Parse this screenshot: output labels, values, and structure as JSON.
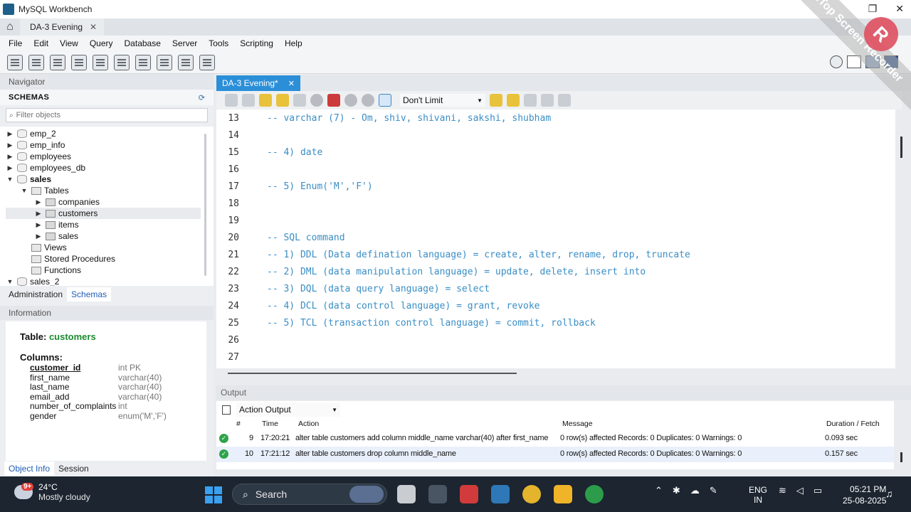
{
  "window": {
    "title": "MySQL Workbench",
    "controls": [
      "❐",
      "✕"
    ]
  },
  "connection_tab": {
    "label": "DA-3 Evening",
    "close": "✕"
  },
  "menu": [
    "File",
    "Edit",
    "View",
    "Query",
    "Database",
    "Server",
    "Tools",
    "Scripting",
    "Help"
  ],
  "navigator": {
    "title": "Navigator",
    "schemas_title": "SCHEMAS",
    "filter_placeholder": "Filter objects",
    "tree": [
      {
        "label": "emp_2",
        "kind": "schema",
        "arrow": "▶"
      },
      {
        "label": "emp_info",
        "kind": "schema",
        "arrow": "▶"
      },
      {
        "label": "employees",
        "kind": "schema",
        "arrow": "▶"
      },
      {
        "label": "employees_db",
        "kind": "schema",
        "arrow": "▶"
      },
      {
        "label": "sales",
        "kind": "schema",
        "arrow": "▼"
      },
      {
        "label": "Tables",
        "kind": "folder",
        "arrow": "▼"
      },
      {
        "label": "companies",
        "kind": "table",
        "arrow": "▶"
      },
      {
        "label": "customers",
        "kind": "table",
        "arrow": "▶"
      },
      {
        "label": "items",
        "kind": "table",
        "arrow": "▶"
      },
      {
        "label": "sales",
        "kind": "table",
        "arrow": "▶"
      },
      {
        "label": "Views",
        "kind": "folder",
        "arrow": ""
      },
      {
        "label": "Stored Procedures",
        "kind": "folder",
        "arrow": ""
      },
      {
        "label": "Functions",
        "kind": "folder",
        "arrow": ""
      },
      {
        "label": "sales_2",
        "kind": "schema",
        "arrow": "▼"
      }
    ],
    "tabs": [
      "Administration",
      "Schemas"
    ]
  },
  "information": {
    "title": "Information",
    "table_label": "Table:",
    "table_name": "customers",
    "columns_label": "Columns:",
    "columns": [
      {
        "name": "customer_id",
        "type": "int PK"
      },
      {
        "name": "first_name",
        "type": "varchar(40)"
      },
      {
        "name": "last_name",
        "type": "varchar(40)"
      },
      {
        "name": "email_add",
        "type": "varchar(40)"
      },
      {
        "name": "number_of_complaints",
        "type": "int"
      },
      {
        "name": "gender",
        "type": "enum('M','F')"
      }
    ],
    "tabs": [
      "Object Info",
      "Session"
    ]
  },
  "editor": {
    "tab_label": "DA-3 Evening*",
    "tab_close": "✕",
    "limit": "Don't Limit",
    "lines": [
      {
        "n": "13",
        "text": "-- varchar (7) - Om, shiv, shivani, sakshi, shubham"
      },
      {
        "n": "14",
        "text": ""
      },
      {
        "n": "15",
        "text": "-- 4) date"
      },
      {
        "n": "16",
        "text": ""
      },
      {
        "n": "17",
        "text": "-- 5) Enum('M','F')"
      },
      {
        "n": "18",
        "text": ""
      },
      {
        "n": "19",
        "text": ""
      },
      {
        "n": "20",
        "text": "-- SQL command"
      },
      {
        "n": "21",
        "text": "-- 1) DDL (Data defination language) = create, alter, rename, drop, truncate"
      },
      {
        "n": "22",
        "text": "-- 2) DML (data manipulation language) = update, delete, insert into"
      },
      {
        "n": "23",
        "text": "-- 3) DQL (data query language) = select"
      },
      {
        "n": "24",
        "text": "-- 4) DCL (data control language) = grant, revoke"
      },
      {
        "n": "25",
        "text": "-- 5) TCL (transaction control language) = commit, rollback"
      },
      {
        "n": "26",
        "text": ""
      },
      {
        "n": "27",
        "text": ""
      }
    ]
  },
  "output": {
    "title": "Output",
    "mode": "Action Output",
    "headers": {
      "num": "#",
      "time": "Time",
      "action": "Action",
      "message": "Message",
      "duration": "Duration / Fetch"
    },
    "rows": [
      {
        "num": "9",
        "time": "17:20:21",
        "action": "alter table customers add column middle_name varchar(40) after first_name",
        "message": "0 row(s) affected Records: 0  Duplicates: 0  Warnings: 0",
        "duration": "0.093 sec"
      },
      {
        "num": "10",
        "time": "17:21:12",
        "action": "alter table customers drop column middle_name",
        "message": "0 row(s) affected Records: 0  Duplicates: 0  Warnings: 0",
        "duration": "0.157 sec"
      }
    ]
  },
  "watermark": {
    "text": "iTop Screen Recorder",
    "logo": "R"
  },
  "taskbar": {
    "weather_badge": "9+",
    "temperature": "24°C",
    "condition": "Mostly cloudy",
    "search_label": "Search",
    "lang_line1": "ENG",
    "lang_line2": "IN",
    "time": "05:21 PM",
    "date": "25-08-2025"
  }
}
